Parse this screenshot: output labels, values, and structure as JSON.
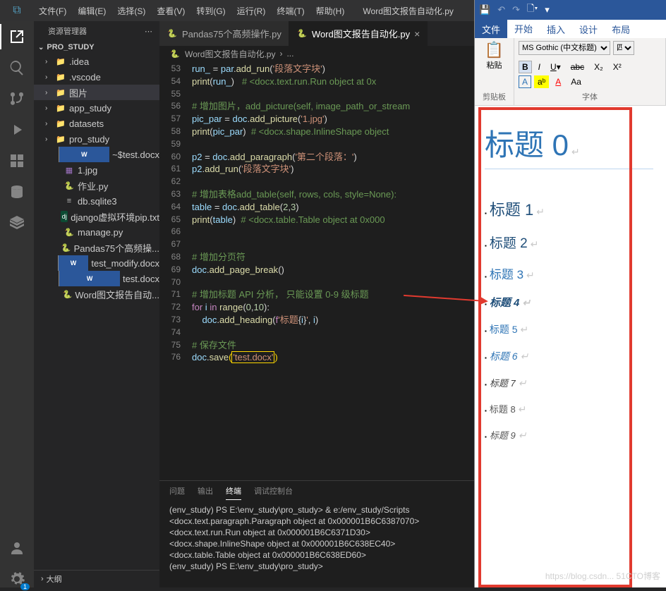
{
  "vscode": {
    "menus": [
      "文件(F)",
      "编辑(E)",
      "选择(S)",
      "查看(V)",
      "转到(G)",
      "运行(R)",
      "终端(T)",
      "帮助(H)"
    ],
    "title": "Word图文报告自动化.py",
    "explorer_label": "资源管理器",
    "project": "PRO_STUDY",
    "outline": "大纲",
    "tree": [
      {
        "depth": 1,
        "chev": "›",
        "icon": "folder",
        "label": ".idea"
      },
      {
        "depth": 1,
        "chev": "›",
        "icon": "folder",
        "label": ".vscode"
      },
      {
        "depth": 1,
        "chev": "›",
        "icon": "folder",
        "label": "图片",
        "sel": true
      },
      {
        "depth": 1,
        "chev": "›",
        "icon": "folder",
        "label": "app_study"
      },
      {
        "depth": 1,
        "chev": "›",
        "icon": "folder",
        "label": "datasets"
      },
      {
        "depth": 1,
        "chev": "›",
        "icon": "folder",
        "label": "pro_study"
      },
      {
        "depth": 2,
        "chev": "",
        "icon": "word",
        "label": "~$test.docx"
      },
      {
        "depth": 2,
        "chev": "",
        "icon": "img",
        "label": "1.jpg"
      },
      {
        "depth": 2,
        "chev": "",
        "icon": "py",
        "label": "作业.py"
      },
      {
        "depth": 2,
        "chev": "",
        "icon": "db",
        "label": "db.sqlite3"
      },
      {
        "depth": 2,
        "chev": "",
        "icon": "dj",
        "label": "django虚拟环境pip.txt"
      },
      {
        "depth": 2,
        "chev": "",
        "icon": "py",
        "label": "manage.py"
      },
      {
        "depth": 2,
        "chev": "",
        "icon": "py",
        "label": "Pandas75个高频操..."
      },
      {
        "depth": 2,
        "chev": "",
        "icon": "word",
        "label": "test_modify.docx"
      },
      {
        "depth": 2,
        "chev": "",
        "icon": "word",
        "label": "test.docx"
      },
      {
        "depth": 2,
        "chev": "",
        "icon": "py",
        "label": "Word图文报告自动..."
      }
    ],
    "tabs": [
      {
        "label": "Pandas75个高频操作.py",
        "active": false
      },
      {
        "label": "Word图文报告自动化.py",
        "active": true
      }
    ],
    "breadcrumb": [
      "Word图文报告自动化.py",
      "..."
    ],
    "code": [
      {
        "n": 53,
        "html": "<span class='c-var'>run_</span> = <span class='c-var'>par</span>.<span class='c-fn'>add_run</span>(<span class='c-str'>'段落文字块'</span>)"
      },
      {
        "n": 54,
        "html": "<span class='c-fn'>print</span>(<span class='c-var'>run_</span>)   <span class='c-cm'># &lt;docx.text.run.Run object at 0x</span>"
      },
      {
        "n": 55,
        "html": ""
      },
      {
        "n": 56,
        "html": "<span class='c-cm'># 增加图片，add_picture(self, image_path_or_stream</span>"
      },
      {
        "n": 57,
        "html": "<span class='c-var'>pic_par</span> = <span class='c-var'>doc</span>.<span class='c-fn'>add_picture</span>(<span class='c-str'>'1.jpg'</span>)"
      },
      {
        "n": 58,
        "html": "<span class='c-fn'>print</span>(<span class='c-var'>pic_par</span>)  <span class='c-cm'># &lt;docx.shape.InlineShape object </span>"
      },
      {
        "n": 59,
        "html": ""
      },
      {
        "n": 60,
        "html": "<span class='c-var'>p2</span> = <span class='c-var'>doc</span>.<span class='c-fn'>add_paragraph</span>(<span class='c-str'>'第二个段落：'</span>)"
      },
      {
        "n": 61,
        "html": "<span class='c-var'>p2</span>.<span class='c-fn'>add_run</span>(<span class='c-str'>'段落文字块'</span>)"
      },
      {
        "n": 62,
        "html": ""
      },
      {
        "n": 63,
        "html": "<span class='c-cm'># 增加表格add_table(self, rows, cols, style=None):</span>"
      },
      {
        "n": 64,
        "html": "<span class='c-var'>table</span> = <span class='c-var'>doc</span>.<span class='c-fn'>add_table</span>(<span class='c-num'>2</span>,<span class='c-num'>3</span>)"
      },
      {
        "n": 65,
        "html": "<span class='c-fn'>print</span>(<span class='c-var'>table</span>)  <span class='c-cm'># &lt;docx.table.Table object at 0x000</span>"
      },
      {
        "n": 66,
        "html": ""
      },
      {
        "n": 67,
        "html": ""
      },
      {
        "n": 68,
        "html": "<span class='c-cm'># 增加分页符</span>"
      },
      {
        "n": 69,
        "html": "<span class='c-var'>doc</span>.<span class='c-fn'>add_page_break</span>()"
      },
      {
        "n": 70,
        "html": ""
      },
      {
        "n": 71,
        "html": "<span class='c-cm'># 增加标题 API 分析， 只能设置 0-9 级标题</span>"
      },
      {
        "n": 72,
        "html": "<span class='c-kw'>for</span> <span class='c-var'>i</span> <span class='c-kw'>in</span> <span class='c-fn'>range</span>(<span class='c-num'>0</span>,<span class='c-num'>10</span>):"
      },
      {
        "n": 73,
        "html": "    <span class='c-var'>doc</span>.<span class='c-fn'>add_heading</span>(<span class='c-kw'>f</span><span class='c-str'>'标题</span>{<span class='c-var'>i</span>}<span class='c-str'>'</span>, <span class='c-var'>i</span>)"
      },
      {
        "n": 74,
        "html": ""
      },
      {
        "n": 75,
        "html": "<span class='c-cm'># 保存文件</span>"
      },
      {
        "n": 76,
        "html": "<span class='c-var'>doc</span>.<span class='c-fn'>save</span><span class='c-par'>(</span><span class='cursor'><span class='c-str'>'test.docx'</span></span><span class='c-par'>)</span>"
      }
    ],
    "panel_tabs": [
      "问题",
      "输出",
      "终端",
      "调试控制台"
    ],
    "panel_active": 2,
    "terminal": [
      "(env_study) PS E:\\env_study\\pro_study> & e:/env_study/Scripts",
      "<docx.text.paragraph.Paragraph object at 0x000001B6C6387070>",
      "<docx.text.run.Run object at 0x000001B6C6371D30>",
      "<docx.shape.InlineShape object at 0x000001B6C638EC40>",
      "<docx.table.Table object at 0x000001B6C638ED60>",
      "(env_study) PS E:\\env_study\\pro_study>"
    ],
    "badge": "1"
  },
  "word": {
    "tabs": [
      "文件",
      "开始",
      "插入",
      "设计",
      "布局"
    ],
    "active_tab": 1,
    "font_name": "MS Gothic (中文标题)",
    "font_size": "四",
    "groups": {
      "clipboard": "剪贴板",
      "paste": "粘贴",
      "font": "字体"
    },
    "buttons": {
      "b": "B",
      "i": "I",
      "u": "U",
      "abc": "abc",
      "x2": "X₂",
      "x2u": "X²",
      "a1": "A",
      "a2": "aᵇ",
      "a3": "A",
      "aa": "Aa"
    },
    "headings": [
      "标题 0",
      "标题 1",
      "标题 2",
      "标题 3",
      "标题 4",
      "标题 5",
      "标题 6",
      "标题 7",
      "标题 8",
      "标题 9"
    ]
  },
  "watermark": "https://blog.csdn... 51CTO博客"
}
